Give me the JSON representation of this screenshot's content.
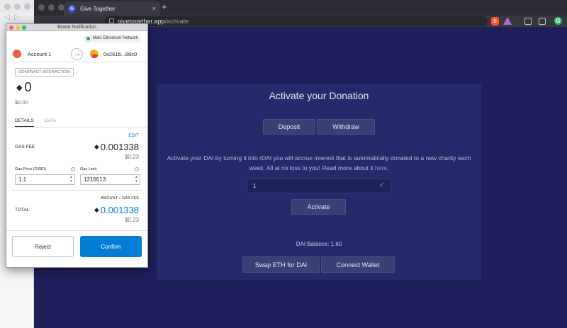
{
  "browser": {
    "tab_title": "Give Together",
    "tab_favicon_letter": "G",
    "tab_close": "×",
    "new_tab": "+",
    "url_domain": "givetogether.app",
    "url_path": "/activate",
    "brave_ext_letter": "b",
    "green_ext_letter": "G"
  },
  "page": {
    "card_title": "Activate your Donation",
    "deposit_label": "Deposit",
    "withdraw_label": "Withdraw",
    "description_line1": "Activate your DAI by turning it into rDAI you will accrue interest that is automatically donated to a new charity each",
    "description_line2_prefix": "week. All at no loss to you! Read more about it ",
    "description_link": "here",
    "description_suffix": ".",
    "select_value": "1",
    "select_check": "✓",
    "activate_label": "Activate",
    "dai_balance": "DAI Balance: 1.60",
    "swap_label": "Swap ETH for DAI",
    "connect_label": "Connect Wallet"
  },
  "popup": {
    "window_title": "Brave Notification",
    "network": "Main Ethereum Network",
    "account_name": "Account 1",
    "arrow": "→",
    "destination": "0x261b...88c0",
    "badge": "CONTRACT INTERACTION",
    "eth_glyph": "◆",
    "amount": "0",
    "amount_usd": "$0.00",
    "tab_details": "DETAILS",
    "tab_data": "DATA",
    "edit": "EDIT",
    "gas_fee_label": "GAS FEE",
    "gas_fee_value": "0.001338",
    "gas_fee_usd": "$0.23",
    "gas_price_label": "Gas Price (GWEI)",
    "gas_price_value": "1.1",
    "gas_limit_label": "Gas Limit",
    "gas_limit_value": "1216513",
    "info_glyph": "i",
    "amount_gas_label": "AMOUNT + GAS FEE",
    "total_label": "TOTAL",
    "total_value": "0.001338",
    "total_usd": "$0.23",
    "reject_label": "Reject",
    "confirm_label": "Confirm"
  },
  "colors": {
    "page_bg": "#1e1f5a",
    "card_bg": "#272a6a",
    "metamask_blue": "#037dd6",
    "link_purple": "#a083ff"
  }
}
